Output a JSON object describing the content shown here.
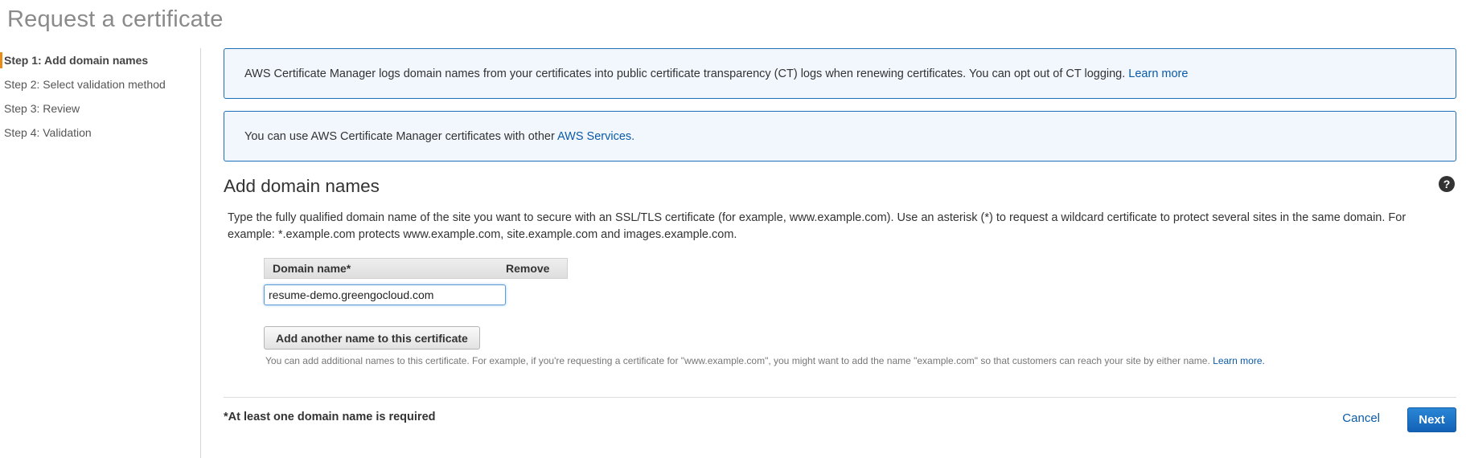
{
  "page": {
    "title": "Request a certificate"
  },
  "sidebar": {
    "steps": [
      {
        "label": "Step 1: Add domain names",
        "active": true
      },
      {
        "label": "Step 2: Select validation method",
        "active": false
      },
      {
        "label": "Step 3: Review",
        "active": false
      },
      {
        "label": "Step 4: Validation",
        "active": false
      }
    ]
  },
  "notices": {
    "ct_logging": {
      "text": "AWS Certificate Manager logs domain names from your certificates into public certificate transparency (CT) logs when renewing certificates. You can opt out of CT logging. ",
      "link": "Learn more"
    },
    "services": {
      "text": "You can use AWS Certificate Manager certificates with other ",
      "link": "AWS Services."
    }
  },
  "section": {
    "title": "Add domain names",
    "help_icon": "?",
    "description": "Type the fully qualified domain name of the site you want to secure with an SSL/TLS certificate (for example, www.example.com). Use an asterisk (*) to request a wildcard certificate to protect several sites in the same domain. For example: *.example.com protects www.example.com, site.example.com and images.example.com."
  },
  "domain_table": {
    "headers": {
      "domain": "Domain name*",
      "remove": "Remove"
    },
    "rows": [
      {
        "value": "resume-demo.greengocloud.com"
      }
    ]
  },
  "add_button": {
    "label": "Add another name to this certificate"
  },
  "hint": {
    "text": "You can add additional names to this certificate. For example, if you're requesting a certificate for \"www.example.com\", you might want to add the name \"example.com\" so that customers can reach your site by either name. ",
    "link": "Learn more."
  },
  "footer": {
    "required_note": "*At least one domain name is required",
    "cancel": "Cancel",
    "next": "Next"
  }
}
